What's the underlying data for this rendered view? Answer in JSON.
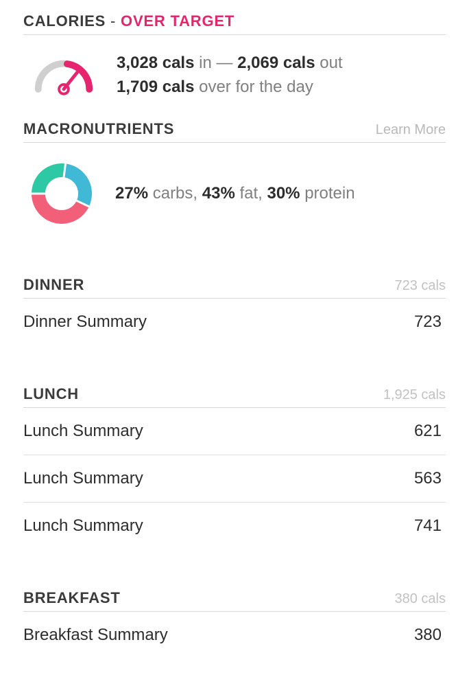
{
  "calories": {
    "title": "CALORIES",
    "dash": " - ",
    "status": "OVER TARGET",
    "in_value": "3,028 cals",
    "in_word": " in ",
    "emdash": "—",
    "out_value": " 2,069 cals",
    "out_word": " out",
    "over_value": "1,709 cals",
    "over_word": " over for the day"
  },
  "macros": {
    "title": "MACRONUTRIENTS",
    "learn_more": "Learn More",
    "carbs_pct": "27%",
    "carbs_word": " carbs, ",
    "fat_pct": "43%",
    "fat_word": " fat, ",
    "protein_pct": "30%",
    "protein_word": " protein",
    "donut": {
      "carbs": 27,
      "fat": 43,
      "protein": 30
    }
  },
  "meals": [
    {
      "title": "DINNER",
      "total": "723 cals",
      "items": [
        {
          "label": "Dinner Summary",
          "value": "723"
        }
      ]
    },
    {
      "title": "LUNCH",
      "total": "1,925 cals",
      "items": [
        {
          "label": "Lunch Summary",
          "value": "621"
        },
        {
          "label": "Lunch Summary",
          "value": "563"
        },
        {
          "label": "Lunch Summary",
          "value": "741"
        }
      ]
    },
    {
      "title": "BREAKFAST",
      "total": "380 cals",
      "items": [
        {
          "label": "Breakfast Summary",
          "value": "380"
        }
      ]
    }
  ],
  "colors": {
    "accent": "#e6256e",
    "carbs": "#2dc9a4",
    "fat": "#f15f79",
    "protein": "#3fb9d6",
    "gauge_light": "#cfcfcf"
  }
}
